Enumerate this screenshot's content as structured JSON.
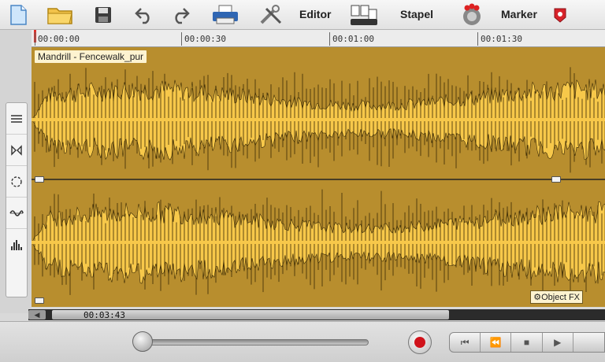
{
  "toolbar": {
    "editor_label": "Editor",
    "stapel_label": "Stapel",
    "marker_label": "Marker"
  },
  "ruler": {
    "ticks": [
      "00:00:00",
      "00:00:30",
      "00:01:00",
      "00:01:30"
    ]
  },
  "clip": {
    "title": "Mandrill - Fencewalk_pur",
    "object_fx_label": "Object FX"
  },
  "position": {
    "time": "00:03:43"
  },
  "colors": {
    "wave_bg": "#b88e2e",
    "wave_fill": "#f7c84a",
    "record": "#d0121a"
  }
}
